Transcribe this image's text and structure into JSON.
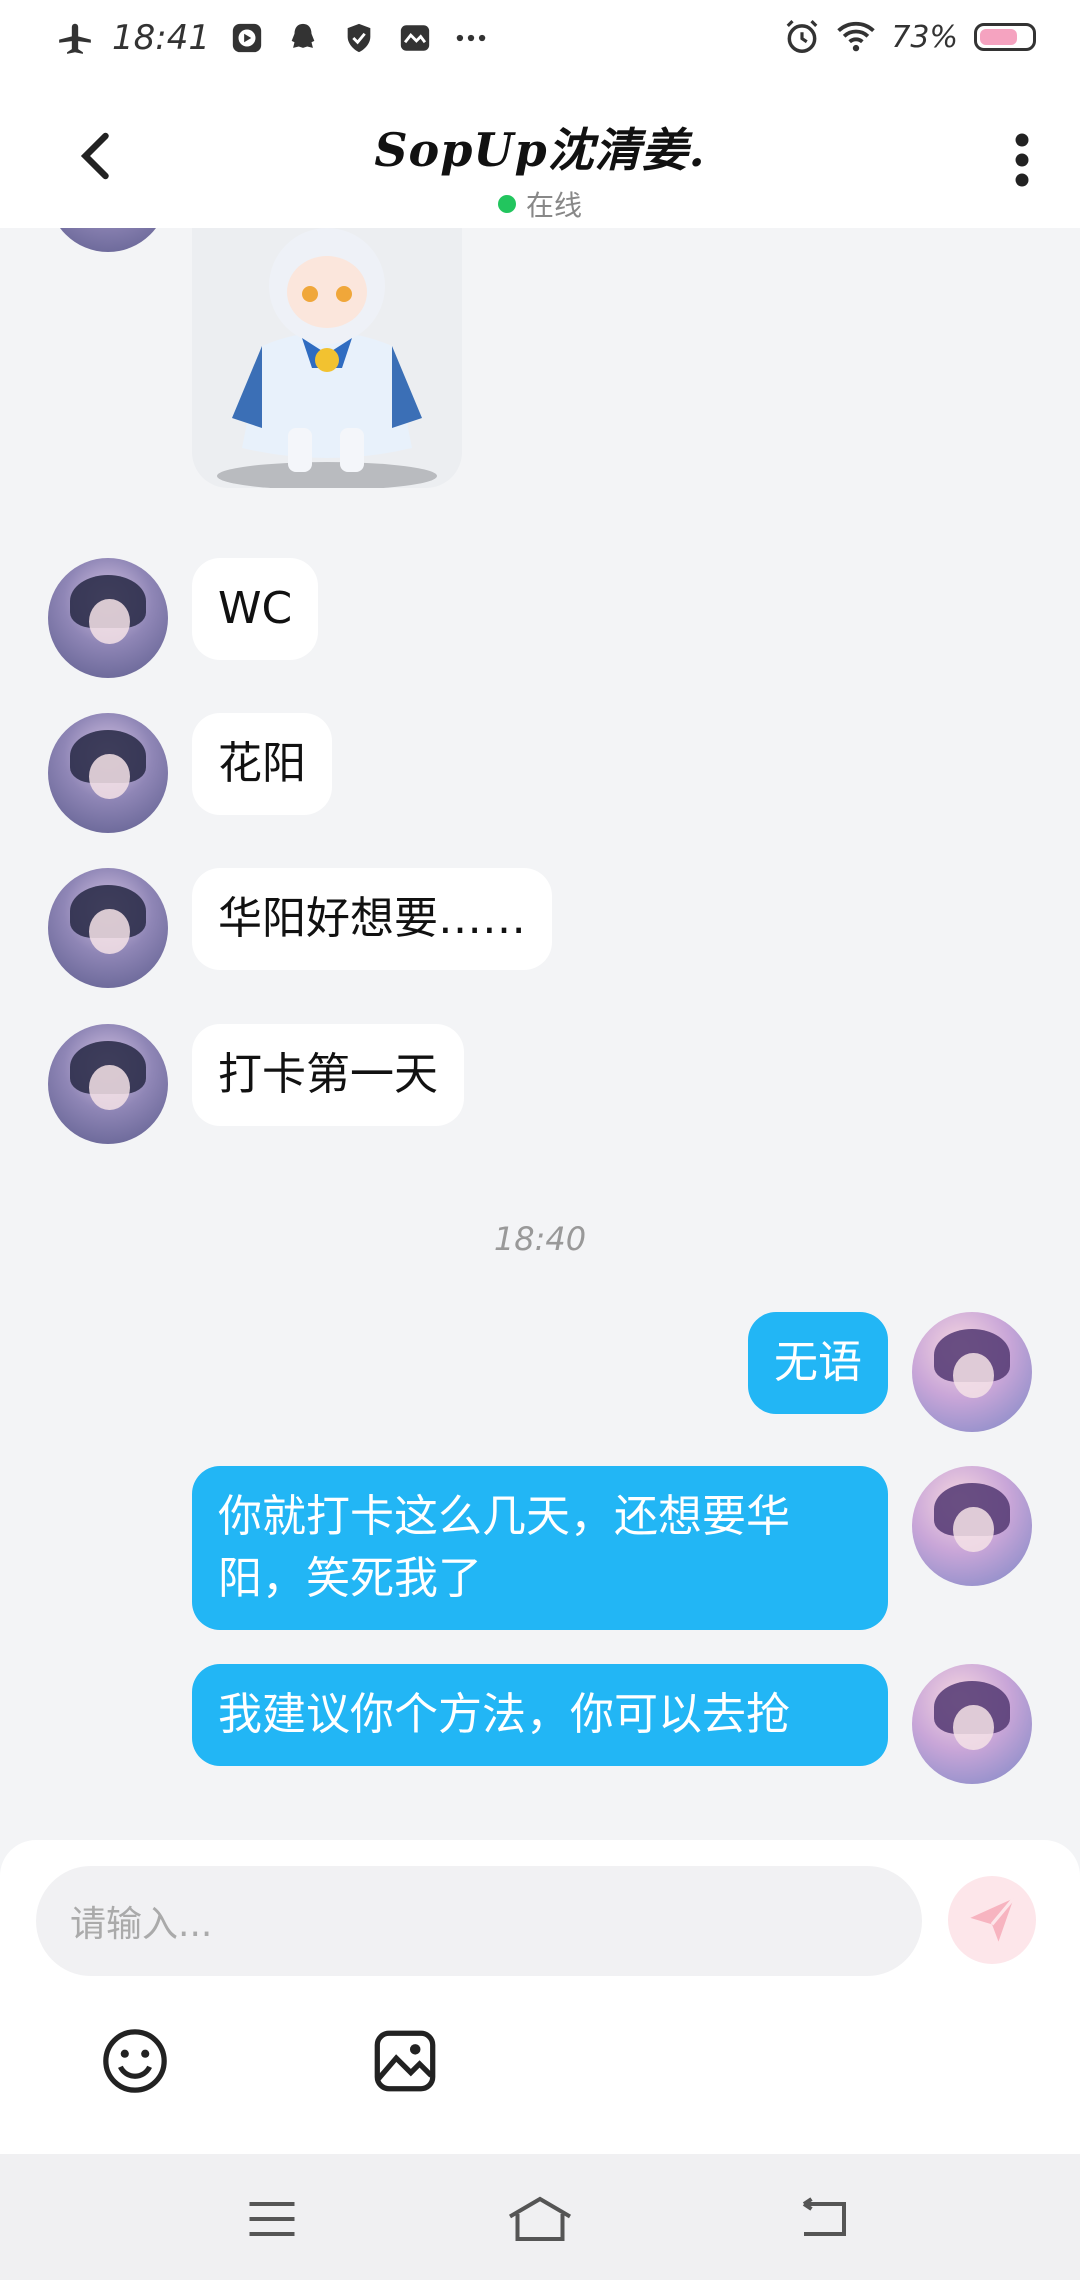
{
  "status_bar": {
    "time": "18:41",
    "battery": "73%"
  },
  "header": {
    "title": "SopUp沈清姜.",
    "presence": "在线"
  },
  "messages": [
    {
      "side": "in",
      "text": "WC"
    },
    {
      "side": "in",
      "text": "花阳"
    },
    {
      "side": "in",
      "text": "华阳好想要……"
    },
    {
      "side": "in",
      "text": "打卡第一天"
    },
    {
      "side": "out",
      "text": "无语"
    },
    {
      "side": "out",
      "text": "你就打卡这么几天，还想要华阳，笑死我了"
    },
    {
      "side": "out",
      "text": "我建议你个方法，你可以去抢"
    }
  ],
  "timestamp": "18:40",
  "composer": {
    "placeholder": "请输入..."
  },
  "colors": {
    "outgoing_bubble": "#22b6f5",
    "incoming_bubble": "#ffffff",
    "online_dot": "#22c55e"
  }
}
